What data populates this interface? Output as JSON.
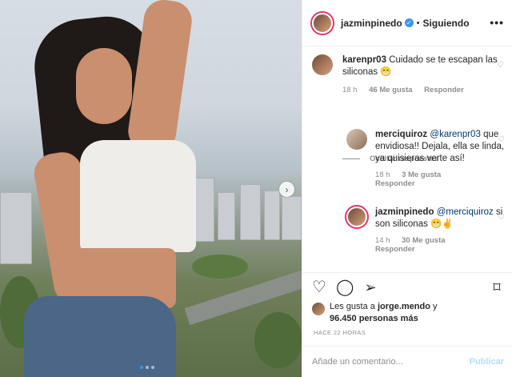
{
  "post": {
    "username": "jazminpinedo",
    "verified_icon": "verified-badge-icon",
    "separator": "•",
    "follow_status": "Siguiendo",
    "more_icon": "•••"
  },
  "media": {
    "carousel_dots": 3,
    "active_dot": 1,
    "next_icon": "›"
  },
  "comments": [
    {
      "username": "karenpr03",
      "text": "Cuidado se te escapan las siliconas 😁",
      "time": "18 h",
      "likes": "46 Me gusta",
      "reply": "Responder"
    }
  ],
  "hide_replies": "Ocultar respuestas",
  "replies": [
    {
      "username": "merciquiroz",
      "mention": "@karenpr03",
      "text": "que envidiosa!! Dejala, ella se linda, ya quisieras verte así!",
      "time": "18 h",
      "likes": "3 Me gusta",
      "reply": "Responder"
    },
    {
      "username": "jazminpinedo",
      "mention": "@merciquiroz",
      "text": "si son siliconas 😁✌",
      "time": "14 h",
      "likes": "30 Me gusta",
      "reply": "Responder"
    }
  ],
  "likes": {
    "prefix": "Les gusta a",
    "user": "jorge.mendo",
    "conj": "y",
    "count": "96.450 personas más"
  },
  "timestamp": "HACE 22 HORAS",
  "add_comment": {
    "placeholder": "Añade un comentario...",
    "publish": "Publicar"
  },
  "colors": {
    "accent": "#3897f0",
    "text": "#262626",
    "muted": "#8e8e8e",
    "publish_disabled": "#b2dffc"
  }
}
